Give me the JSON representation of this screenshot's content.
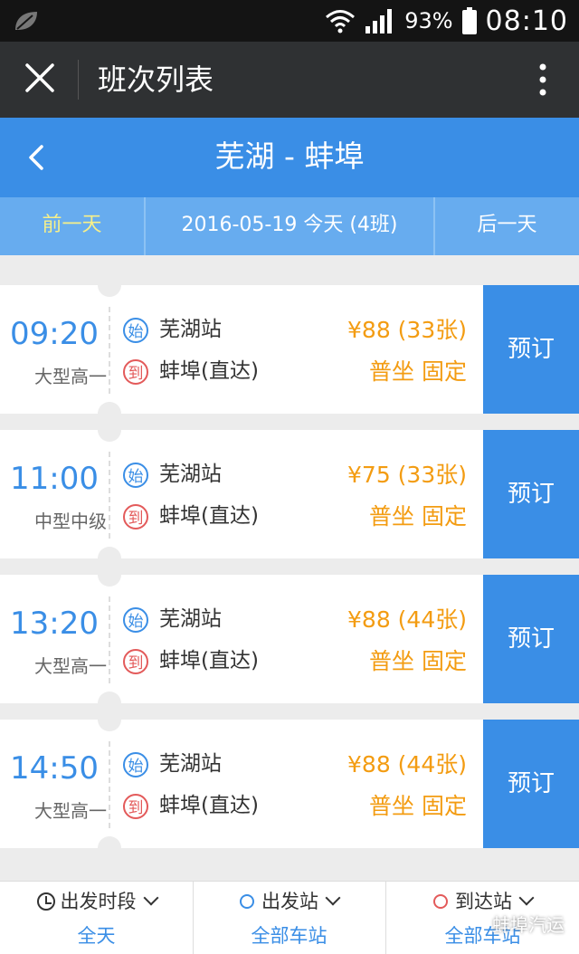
{
  "status_bar": {
    "battery": "93%",
    "time": "08:10"
  },
  "app_bar": {
    "title": "班次列表"
  },
  "route_bar": {
    "route": "芜湖 - 蚌埠"
  },
  "date_bar": {
    "prev_label": "前一天",
    "current_label": "2016-05-19 今天 (4班)",
    "next_label": "后一天"
  },
  "trips": [
    {
      "time": "09:20",
      "bus_type": "大型高一",
      "from_badge": "始",
      "from_station": "芜湖站",
      "to_badge": "到",
      "to_station": "蚌埠(直达)",
      "price": "¥88 (33张)",
      "seat_info": "普坐 固定",
      "book_label": "预订"
    },
    {
      "time": "11:00",
      "bus_type": "中型中级",
      "from_badge": "始",
      "from_station": "芜湖站",
      "to_badge": "到",
      "to_station": "蚌埠(直达)",
      "price": "¥75 (33张)",
      "seat_info": "普坐 固定",
      "book_label": "预订"
    },
    {
      "time": "13:20",
      "bus_type": "大型高一",
      "from_badge": "始",
      "from_station": "芜湖站",
      "to_badge": "到",
      "to_station": "蚌埠(直达)",
      "price": "¥88 (44张)",
      "seat_info": "普坐 固定",
      "book_label": "预订"
    },
    {
      "time": "14:50",
      "bus_type": "大型高一",
      "from_badge": "始",
      "from_station": "芜湖站",
      "to_badge": "到",
      "to_station": "蚌埠(直达)",
      "price": "¥88 (44张)",
      "seat_info": "普坐 固定",
      "book_label": "预订"
    }
  ],
  "filters": {
    "time": {
      "label": "出发时段",
      "value": "全天"
    },
    "departure": {
      "label": "出发站",
      "value": "全部车站"
    },
    "arrival": {
      "label": "到达站",
      "value": "全部车站"
    }
  },
  "watermark": "蚌埠汽运",
  "colors": {
    "primary": "#3a8ee6",
    "price": "#f39c12",
    "arrive_badge": "#e35a5a",
    "prev_day": "#f7f08a"
  }
}
